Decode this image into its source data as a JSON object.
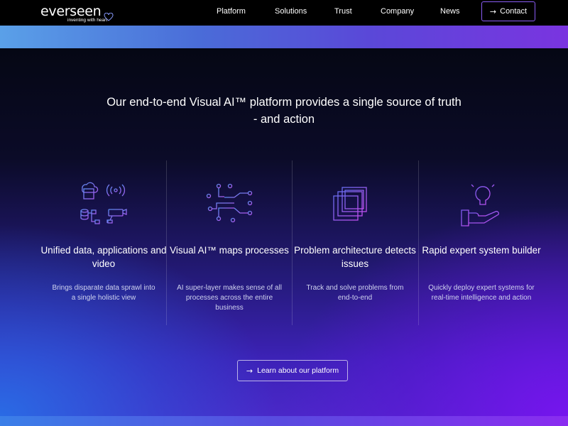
{
  "header": {
    "logo_text": "everseen",
    "logo_tagline": "inventing with heart",
    "nav": [
      {
        "label": "Platform"
      },
      {
        "label": "Solutions"
      },
      {
        "label": "Trust"
      },
      {
        "label": "Company"
      },
      {
        "label": "News"
      }
    ],
    "contact_label": "Contact",
    "contact_icon": "arrow-right-icon"
  },
  "main": {
    "headline": "Our end-to-end Visual AI™ platform provides a single source of truth - and action",
    "features": [
      {
        "icon": "data-sources-icon",
        "title": "Unified data, applications and video",
        "description": "Brings disparate data sprawl into a single holistic view"
      },
      {
        "icon": "process-map-icon",
        "title": "Visual AI™ maps processes",
        "description": "AI super-layer makes sense of all processes across the entire business"
      },
      {
        "icon": "problem-architecture-icon",
        "title": "Problem architecture detects issues",
        "description": "Track and solve problems from end-to-end"
      },
      {
        "icon": "lightbulb-hand-icon",
        "title": "Rapid expert system builder",
        "description": "Quickly deploy expert systems for real-time intelligence and action"
      }
    ],
    "cta_label": "Learn about our platform",
    "cta_icon": "arrow-right-icon"
  },
  "colors": {
    "accent_purple": "#8a5cf6",
    "icon_blue": "#5b8cf0",
    "icon_purple": "#a45cf0",
    "background_dark": "#050714"
  }
}
